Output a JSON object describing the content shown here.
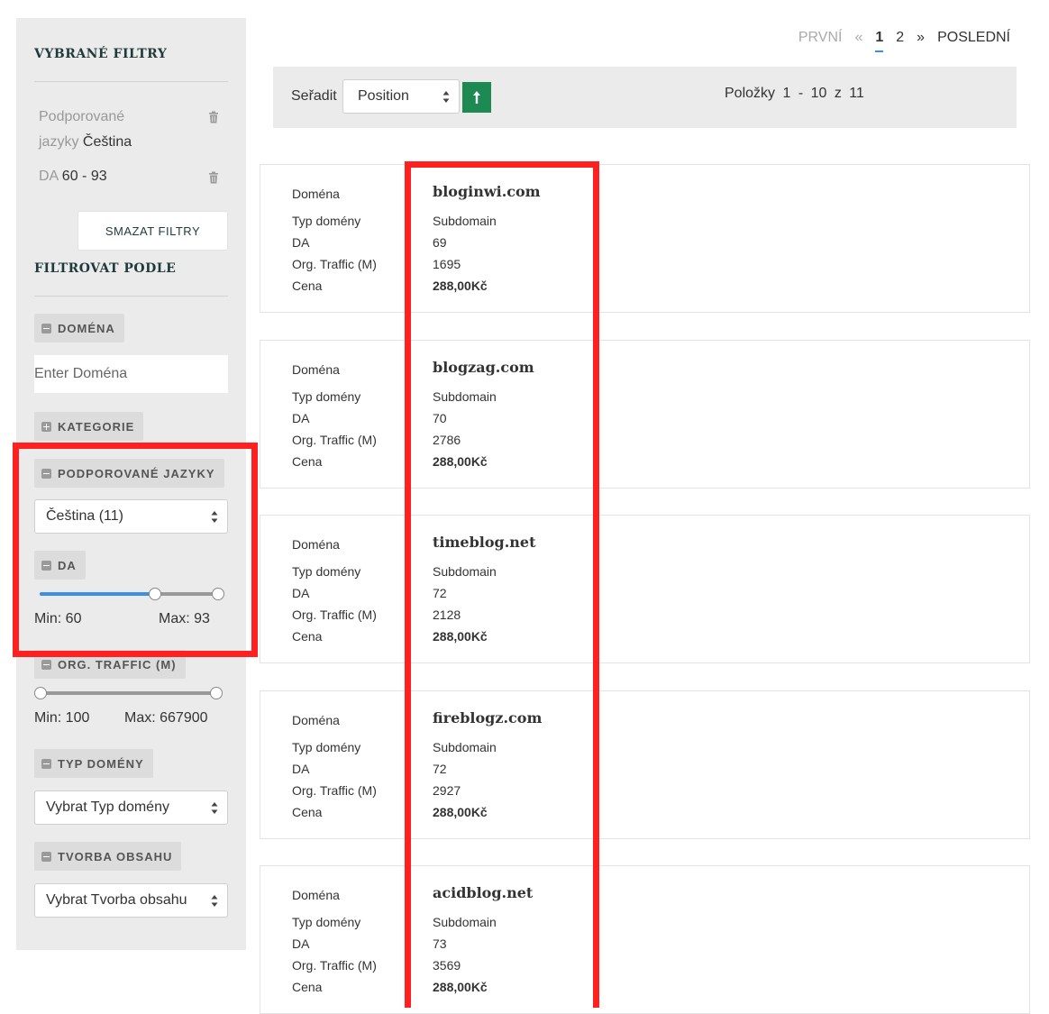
{
  "sidebar": {
    "selected_title": "VYBRANÉ FILTRY",
    "active_filters": [
      {
        "label_line1": "Podporované",
        "label_line2": "jazyky",
        "value": "Čeština"
      },
      {
        "label": "DA",
        "value": "60 - 93"
      }
    ],
    "clear_label": "SMAZAT FILTRY",
    "filter_title": "FILTROVAT PODLE",
    "domain_filter": {
      "label": "DOMÉNA",
      "placeholder": "Enter Doména"
    },
    "category_filter": {
      "label": "KATEGORIE"
    },
    "lang_filter": {
      "label": "PODPOROVANÉ JAZYKY",
      "selected": "Čeština (11)"
    },
    "da_filter": {
      "label": "DA",
      "min_text": "Min: 60",
      "max_text": "Max: 93",
      "min": 60,
      "max": 93,
      "range_min": 0,
      "range_max": 93
    },
    "traffic_filter": {
      "label": "ORG. TRAFFIC (M)",
      "min_text": "Min: 100",
      "max_text": "Max: 667900",
      "min": 100,
      "max": 667900
    },
    "type_filter": {
      "label": "TYP DOMÉNY",
      "selected": "Vybrat Typ domény"
    },
    "content_filter": {
      "label": "TVORBA OBSAHU",
      "selected": "Vybrat Tvorba obsahu"
    }
  },
  "pager": {
    "first": "PRVNÍ",
    "prev": "«",
    "pages": [
      "1",
      "2"
    ],
    "current": "1",
    "next": "»",
    "last": "POSLEDNÍ"
  },
  "toolbar": {
    "sort_label": "Seřadit",
    "sort_value": "Position",
    "items_text": "Položky 1 - 10 z 11"
  },
  "card_labels": {
    "domain": "Doména",
    "type": "Typ domény",
    "da": "DA",
    "traffic": "Org. Traffic (M)",
    "price": "Cena"
  },
  "products": [
    {
      "domain": "bloginwi.com",
      "type": "Subdomain",
      "da": "69",
      "traffic": "1695",
      "price": "288,00Kč"
    },
    {
      "domain": "blogzag.com",
      "type": "Subdomain",
      "da": "70",
      "traffic": "2786",
      "price": "288,00Kč"
    },
    {
      "domain": "timeblog.net",
      "type": "Subdomain",
      "da": "72",
      "traffic": "2128",
      "price": "288,00Kč"
    },
    {
      "domain": "fireblogz.com",
      "type": "Subdomain",
      "da": "72",
      "traffic": "2927",
      "price": "288,00Kč"
    },
    {
      "domain": "acidblog.net",
      "type": "Subdomain",
      "da": "73",
      "traffic": "3569",
      "price": "288,00Kč"
    }
  ],
  "colors": {
    "highlight": "#ff2020",
    "accent": "#3f8ee6",
    "sort_button": "#1c8a52"
  }
}
